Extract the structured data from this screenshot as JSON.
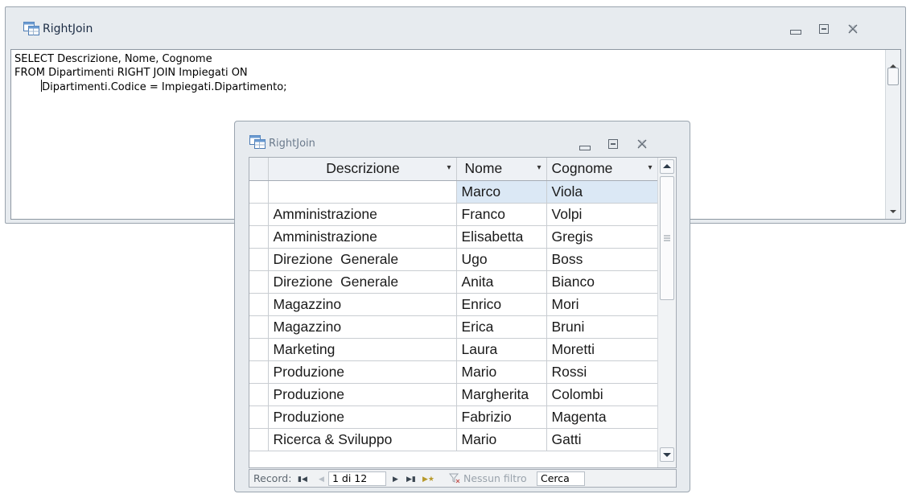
{
  "query_window": {
    "title": "RightJoin",
    "sql_lines": [
      "SELECT Descrizione, Nome, Cognome",
      "FROM Dipartimenti RIGHT JOIN Impiegati ON",
      "ipartimenti.Codice = Impiegati.Dipartimento;"
    ],
    "sql_line3_first_letter": "D",
    "sql_line3_indent": "        "
  },
  "result_window": {
    "title": "RightJoin",
    "columns": [
      "Descrizione",
      "Nome",
      "Cognome"
    ],
    "rows": [
      [
        "",
        "Marco",
        "Viola"
      ],
      [
        "Amministrazione",
        "Franco",
        "Volpi"
      ],
      [
        "Amministrazione",
        "Elisabetta",
        "Gregis"
      ],
      [
        "Direzione  Generale",
        "Ugo",
        "Boss"
      ],
      [
        "Direzione  Generale",
        "Anita",
        "Bianco"
      ],
      [
        "Magazzino",
        "Enrico",
        "Mori"
      ],
      [
        "Magazzino",
        "Erica",
        "Bruni"
      ],
      [
        "Marketing",
        "Laura",
        "Moretti"
      ],
      [
        "Produzione",
        "Mario",
        "Rossi"
      ],
      [
        "Produzione",
        "Margherita",
        "Colombi"
      ],
      [
        "Produzione",
        "Fabrizio",
        "Magenta"
      ],
      [
        "Ricerca & Sviluppo",
        "Mario",
        "Gatti"
      ]
    ],
    "navigation": {
      "record_label": "Record:",
      "position": "1 di 12",
      "filter_label": "Nessun filtro",
      "search_label": "Cerca"
    }
  },
  "icons": {
    "app": "datasheet-window-icon",
    "minimize": "minimize-icon",
    "restore": "restore-icon",
    "close": "close-icon",
    "dropdown": "dropdown-arrow-icon",
    "filter": "filter-icon"
  },
  "colors": {
    "window_frame": "#e7ebef",
    "selected_row": "#dbe8f5",
    "title_text": "#1c2c44"
  }
}
